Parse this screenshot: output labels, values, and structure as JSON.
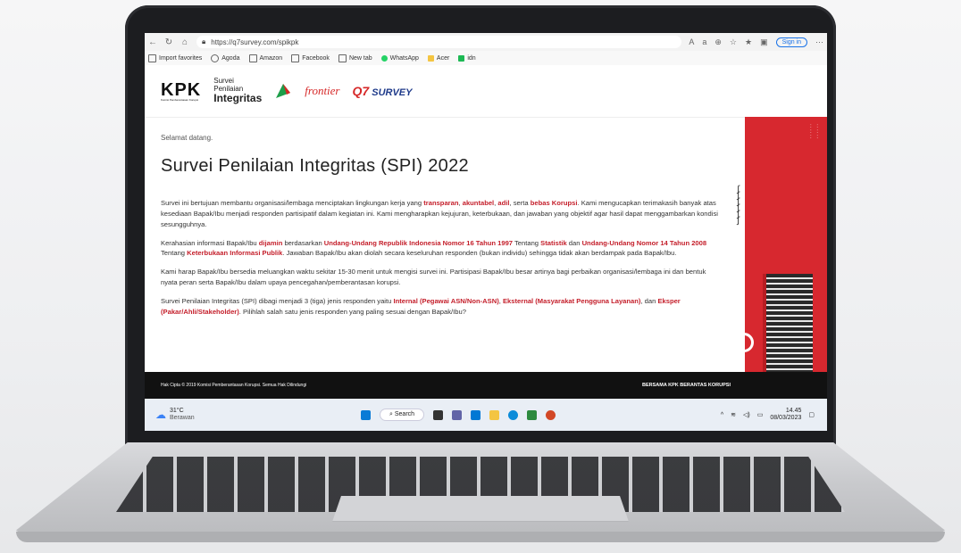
{
  "browser": {
    "url": "https://q7survey.com/spikpk",
    "sign_in": "Sign in",
    "favorites": [
      "Import favorites",
      "Agoda",
      "Amazon",
      "Facebook",
      "New tab",
      "WhatsApp",
      "Acer",
      "idn"
    ]
  },
  "header": {
    "kpk": "KPK",
    "kpk_sub": "Komisi Pemberantasan Korupsi",
    "spi_line1": "Survei",
    "spi_line2": "Penilaian",
    "spi_line3": "Integritas",
    "frontier": "frontier",
    "q7": "SURVEY"
  },
  "content": {
    "welcome": "Selamat datang.",
    "title": "Survei Penilaian Integritas (SPI) 2022",
    "p1_a": "Survei ini bertujuan membantu organisasi/lembaga menciptakan lingkungan kerja yang ",
    "p1_h1": "transparan",
    "p1_h2": "akuntabel",
    "p1_h3": "adil",
    "p1_b": ", serta ",
    "p1_h4": "bebas Korupsi",
    "p1_c": ". Kami mengucapkan terimakasih banyak atas kesediaan Bapak/Ibu menjadi responden partisipatif dalam kegiatan ini. Kami mengharapkan kejujuran, keterbukaan, dan jawaban yang objektif agar hasil dapat menggambarkan kondisi sesungguhnya.",
    "p2_a": "Kerahasian informasi Bapak/Ibu ",
    "p2_h1": "dijamin",
    "p2_b": " berdasarkan ",
    "p2_h2": "Undang-Undang Republik Indonesia Nomor 16 Tahun 1997",
    "p2_c": " Tentang ",
    "p2_h3": "Statistik",
    "p2_d": " dan ",
    "p2_h4": "Undang-Undang Nomor 14 Tahun 2008",
    "p2_e": " Tentang ",
    "p2_h5": "Keterbukaan Informasi Publik",
    "p2_f": ". Jawaban Bapak/Ibu akan diolah secara keseluruhan responden (bukan individu) sehingga tidak akan berdampak pada Bapak/Ibu.",
    "p3": "Kami harap Bapak/Ibu bersedia meluangkan waktu sekitar 15-30 menit untuk mengisi survei ini. Partisipasi Bapak/Ibu besar artinya bagi perbaikan organisasi/lembaga ini dan bentuk nyata peran serta Bapak/Ibu dalam upaya pencegahan/pemberantasan korupsi.",
    "p4_a": "Survei Penilaian Integritas (SPI) dibagi menjadi 3 (tiga) jenis responden yaitu ",
    "p4_h1": "Internal (Pegawai ASN/Non-ASN)",
    "p4_h2": "Eksternal (Masyarakat Pengguna Layanan)",
    "p4_b": ", dan ",
    "p4_h3": "Eksper (Pakar/Ahli/Stakeholder)",
    "p4_c": ". Pilihlah salah satu jenis responden yang paling sesuai dengan Bapak/Ibu?"
  },
  "footer": {
    "copyright": "Hak Cipta © 2019 Komisi Pemberantasan Korupsi. Semua Hak Dilindungi",
    "tagline": "BERSAMA KPK BERANTAS KORUPSI"
  },
  "taskbar": {
    "temp": "31°C",
    "weather": "Berawan",
    "search": "Search",
    "time": "14.45",
    "date": "08/03/2023"
  }
}
